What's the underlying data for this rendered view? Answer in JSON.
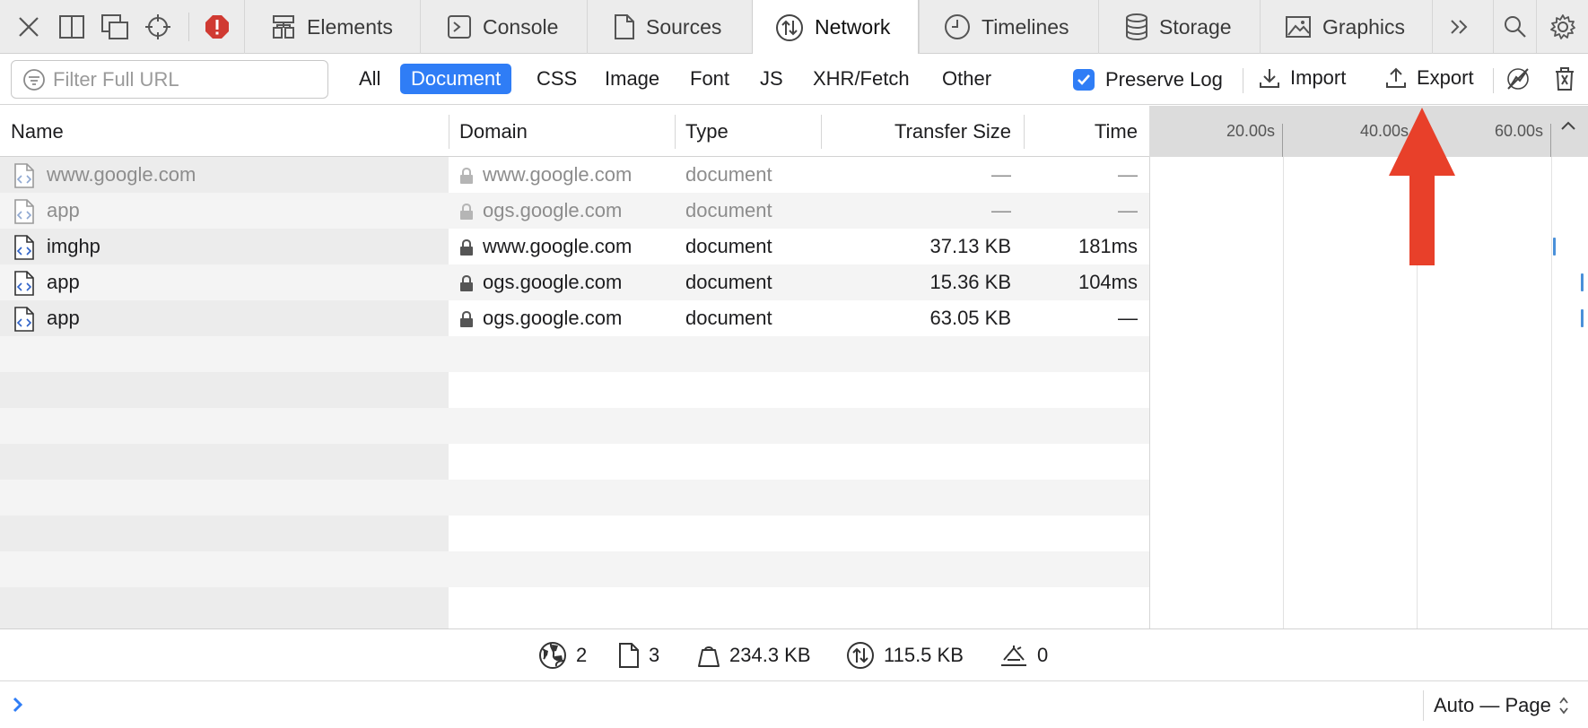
{
  "toolbar": {
    "tabs": [
      {
        "label": "Elements",
        "icon": "elements-icon"
      },
      {
        "label": "Console",
        "icon": "console-icon"
      },
      {
        "label": "Sources",
        "icon": "sources-icon"
      },
      {
        "label": "Network",
        "icon": "network-icon",
        "active": true
      },
      {
        "label": "Timelines",
        "icon": "timelines-icon"
      },
      {
        "label": "Storage",
        "icon": "storage-icon"
      },
      {
        "label": "Graphics",
        "icon": "graphics-icon"
      }
    ]
  },
  "filter": {
    "placeholder": "Filter Full URL",
    "types": [
      "All",
      "Document",
      "CSS",
      "Image",
      "Font",
      "JS",
      "XHR/Fetch",
      "Other"
    ],
    "active_type": "Document",
    "preserve_log_label": "Preserve Log",
    "preserve_log_checked": true,
    "import_label": "Import",
    "export_label": "Export"
  },
  "table": {
    "columns": {
      "name": "Name",
      "domain": "Domain",
      "type": "Type",
      "size": "Transfer Size",
      "time": "Time"
    },
    "timeline_ticks": [
      "20.00s",
      "40.00s",
      "60.00s"
    ],
    "rows": [
      {
        "name": "www.google.com",
        "domain": "www.google.com",
        "type": "document",
        "size": "—",
        "time": "—",
        "dim": true
      },
      {
        "name": "app",
        "domain": "ogs.google.com",
        "type": "document",
        "size": "—",
        "time": "—",
        "dim": true
      },
      {
        "name": "imghp",
        "domain": "www.google.com",
        "type": "document",
        "size": "37.13 KB",
        "time": "181ms",
        "dim": false
      },
      {
        "name": "app",
        "domain": "ogs.google.com",
        "type": "document",
        "size": "15.36 KB",
        "time": "104ms",
        "dim": false
      },
      {
        "name": "app",
        "domain": "ogs.google.com",
        "type": "document",
        "size": "63.05 KB",
        "time": "—",
        "dim": false
      }
    ]
  },
  "status": {
    "domains": "2",
    "resources": "3",
    "size": "234.3 KB",
    "transferred": "115.5 KB",
    "redirects": "0"
  },
  "console": {
    "page_select": "Auto — Page"
  },
  "colors": {
    "accent": "#2f7df6",
    "error_badge": "#d03a32",
    "annotation_arrow": "#e8402a",
    "waterfall_bar": "#4a90d9"
  }
}
